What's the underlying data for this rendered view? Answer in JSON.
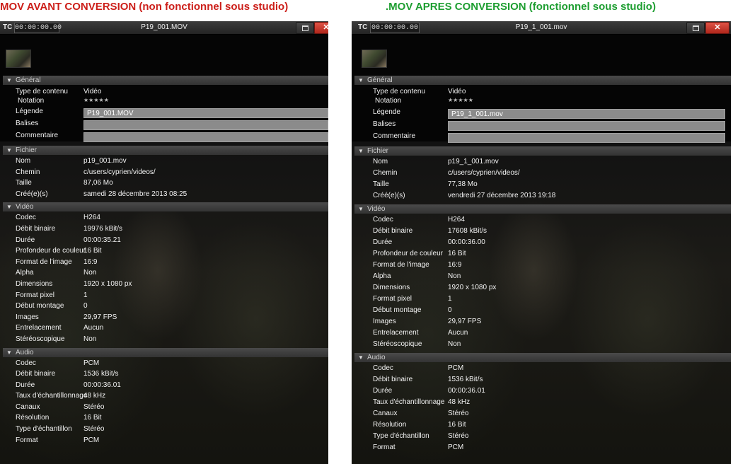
{
  "captions": {
    "left": "MOV AVANT CONVERSION (non fonctionnel sous studio)",
    "right": ".MOV APRES CONVERSION (fonctionnel sous studio)"
  },
  "colors": {
    "left_caption": "#cc1f1a",
    "right_caption": "#1e9e31",
    "panel_bg": "#050505",
    "close_button": "#c8382c"
  },
  "icons": {
    "triangle": "▼",
    "stars": "★★★★★",
    "close": "✕"
  },
  "panels": [
    {
      "tc_label": "TC",
      "timecode": "00:00:00.00",
      "title": "P19_001.MOV",
      "general": {
        "header": "Général",
        "type_label": "Type de contenu",
        "type_value": "Vidéo",
        "notation_label": "Notation",
        "legende_label": "Légende",
        "legende_value": "P19_001.MOV",
        "balises_label": "Balises",
        "commentaire_label": "Commentaire"
      },
      "fichier": {
        "header": "Fichier",
        "rows": [
          {
            "k": "Nom",
            "v": "p19_001.mov"
          },
          {
            "k": "Chemin",
            "v": "c/users/cyprien/videos/"
          },
          {
            "k": "Taille",
            "v": "87,06 Mo"
          },
          {
            "k": "Créé(e)(s)",
            "v": "samedi 28 décembre 2013 08:25"
          }
        ]
      },
      "video": {
        "header": "Vidéo",
        "rows": [
          {
            "k": "Codec",
            "v": "H264"
          },
          {
            "k": "Débit binaire",
            "v": "19976 kBit/s"
          },
          {
            "k": "Durée",
            "v": "00:00:35.21"
          },
          {
            "k": "Profondeur de couleur",
            "v": "16 Bit"
          },
          {
            "k": "Format de l'image",
            "v": "16:9"
          },
          {
            "k": "Alpha",
            "v": "Non"
          },
          {
            "k": "Dimensions",
            "v": "1920 x 1080 px"
          },
          {
            "k": "Format pixel",
            "v": "1"
          },
          {
            "k": "Début montage",
            "v": "0"
          },
          {
            "k": "Images",
            "v": "29,97 FPS"
          },
          {
            "k": "Entrelacement",
            "v": "Aucun"
          },
          {
            "k": "Stéréoscopique",
            "v": "Non"
          }
        ]
      },
      "audio": {
        "header": "Audio",
        "rows": [
          {
            "k": "Codec",
            "v": "PCM"
          },
          {
            "k": "Débit binaire",
            "v": "1536 kBit/s"
          },
          {
            "k": "Durée",
            "v": "00:00:36.01"
          },
          {
            "k": "Taux d'échantillonnage",
            "v": "48 kHz"
          },
          {
            "k": "Canaux",
            "v": "Stéréo"
          },
          {
            "k": "Résolution",
            "v": "16 Bit"
          },
          {
            "k": "Type d'échantillon",
            "v": "Stéréo"
          },
          {
            "k": "Format",
            "v": "PCM"
          }
        ]
      }
    },
    {
      "tc_label": "TC",
      "timecode": "00:00:00.00",
      "title": "P19_1_001.mov",
      "general": {
        "header": "Général",
        "type_label": "Type de contenu",
        "type_value": "Vidéo",
        "notation_label": "Notation",
        "legende_label": "Légende",
        "legende_value": "P19_1_001.mov",
        "balises_label": "Balises",
        "commentaire_label": "Commentaire"
      },
      "fichier": {
        "header": "Fichier",
        "rows": [
          {
            "k": "Nom",
            "v": "p19_1_001.mov"
          },
          {
            "k": "Chemin",
            "v": "c/users/cyprien/videos/"
          },
          {
            "k": "Taille",
            "v": "77,38 Mo"
          },
          {
            "k": "Créé(e)(s)",
            "v": "vendredi 27 décembre 2013 19:18"
          }
        ]
      },
      "video": {
        "header": "Vidéo",
        "rows": [
          {
            "k": "Codec",
            "v": "H264"
          },
          {
            "k": "Débit binaire",
            "v": "17608 kBit/s"
          },
          {
            "k": "Durée",
            "v": "00:00:36.00"
          },
          {
            "k": "Profondeur de couleur",
            "v": "16 Bit"
          },
          {
            "k": "Format de l'image",
            "v": "16:9"
          },
          {
            "k": "Alpha",
            "v": "Non"
          },
          {
            "k": "Dimensions",
            "v": "1920 x 1080 px"
          },
          {
            "k": "Format pixel",
            "v": "1"
          },
          {
            "k": "Début montage",
            "v": "0"
          },
          {
            "k": "Images",
            "v": "29,97 FPS"
          },
          {
            "k": "Entrelacement",
            "v": "Aucun"
          },
          {
            "k": "Stéréoscopique",
            "v": "Non"
          }
        ]
      },
      "audio": {
        "header": "Audio",
        "rows": [
          {
            "k": "Codec",
            "v": "PCM"
          },
          {
            "k": "Débit binaire",
            "v": "1536 kBit/s"
          },
          {
            "k": "Durée",
            "v": "00:00:36.01"
          },
          {
            "k": "Taux d'échantillonnage",
            "v": "48 kHz"
          },
          {
            "k": "Canaux",
            "v": "Stéréo"
          },
          {
            "k": "Résolution",
            "v": "16 Bit"
          },
          {
            "k": "Type d'échantillon",
            "v": "Stéréo"
          },
          {
            "k": "Format",
            "v": "PCM"
          }
        ]
      }
    }
  ]
}
